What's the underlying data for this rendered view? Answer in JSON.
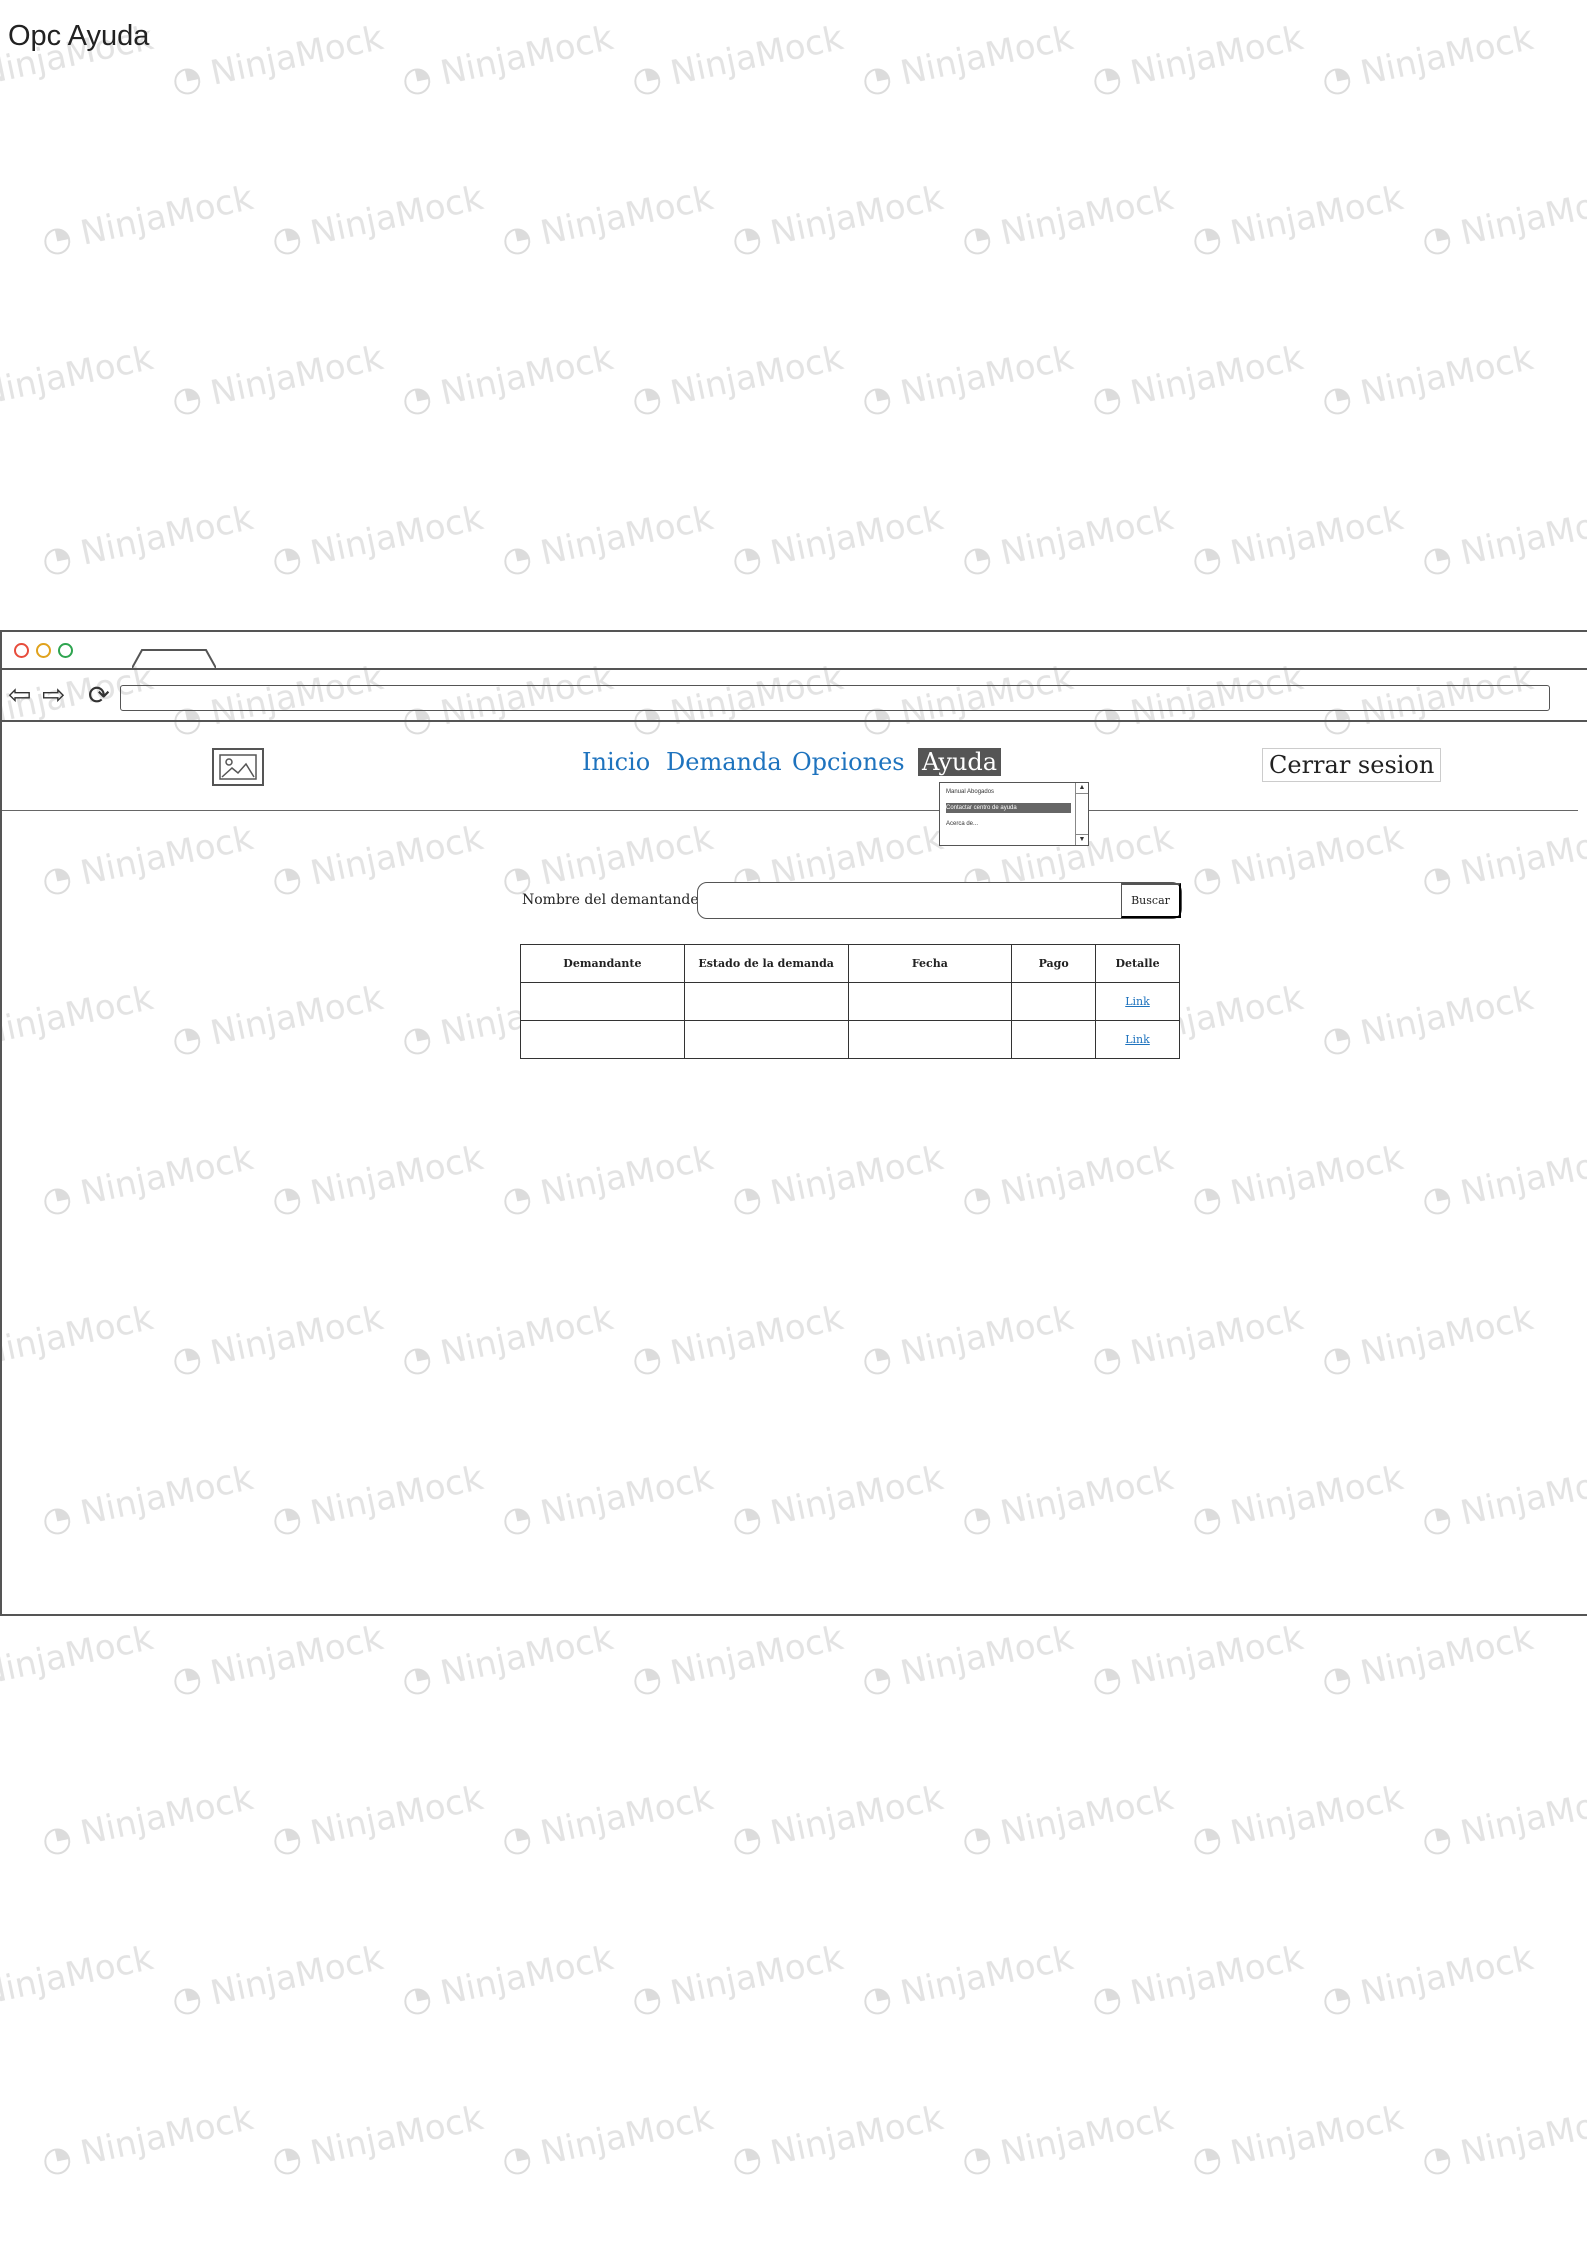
{
  "page": {
    "title": "Opc Ayuda"
  },
  "watermark": {
    "text": "NinjaMock"
  },
  "browser": {
    "controls": {
      "back_icon": "arrow-left-icon",
      "forward_icon": "arrow-right-icon",
      "reload_icon": "reload-icon"
    },
    "address": {
      "value": ""
    }
  },
  "header": {
    "logo_icon": "image-placeholder-icon",
    "nav": [
      {
        "label": "Inicio"
      },
      {
        "label": "Demanda"
      },
      {
        "label": "Opciones"
      },
      {
        "label": "Ayuda",
        "active": true
      }
    ],
    "logout_label": "Cerrar sesion"
  },
  "help_dropdown": {
    "options": [
      {
        "label": "Manual Abogados"
      },
      {
        "label": "Contactar centro de ayuda",
        "selected": true
      },
      {
        "label": "Acerca de..."
      }
    ]
  },
  "search": {
    "label": "Nombre del demantande:",
    "value": "",
    "button_label": "Buscar"
  },
  "table": {
    "columns": [
      "Demandante",
      "Estado de la demanda",
      "Fecha",
      "Pago",
      "Detalle"
    ],
    "rows": [
      [
        "",
        "",
        "",
        "",
        "Link"
      ],
      [
        "",
        "",
        "",
        "",
        "Link"
      ]
    ]
  },
  "colors": {
    "link": "#1e73be",
    "active_nav_bg": "#555555",
    "border": "#555555"
  }
}
